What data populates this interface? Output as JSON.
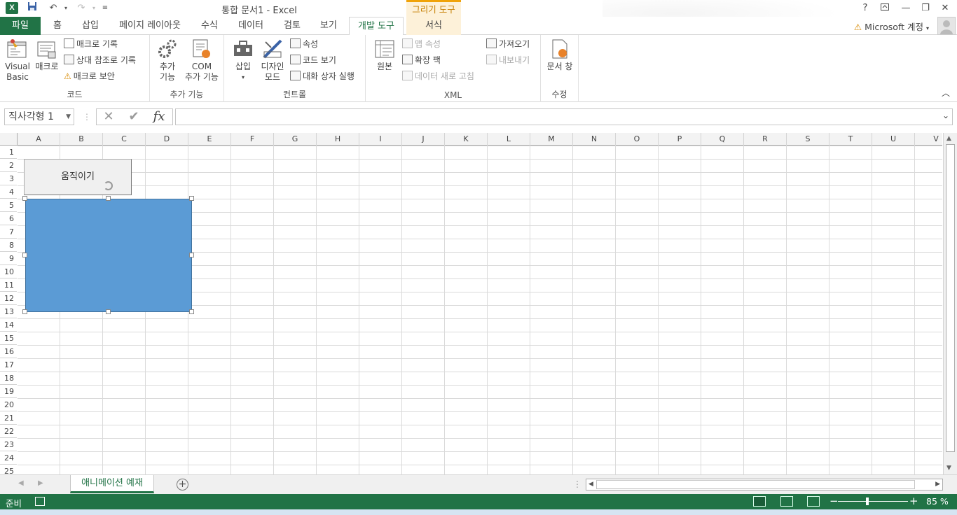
{
  "window": {
    "title": "통합 문서1 - Excel",
    "context_tab_group": "그리기 도구",
    "help": "?",
    "minimize": "—",
    "restore": "❐",
    "close": "✕"
  },
  "tabs": {
    "file": "파일",
    "items": [
      "홈",
      "삽입",
      "페이지 레이아웃",
      "수식",
      "데이터",
      "검토",
      "보기",
      "개발 도구",
      "서식"
    ],
    "active": "개발 도구",
    "account": "Microsoft 계정"
  },
  "ribbon": {
    "code": {
      "label": "코드",
      "visual_basic_1": "Visual",
      "visual_basic_2": "Basic",
      "macro": "매크로",
      "record_macro": "매크로 기록",
      "relative_ref": "상대 참조로 기록",
      "macro_security": "매크로 보안"
    },
    "addins": {
      "label": "추가 기능",
      "addins_1": "추가",
      "addins_2": "기능",
      "com_1": "COM",
      "com_2": "추가 기능"
    },
    "controls": {
      "label": "컨트롤",
      "insert": "삽입",
      "design_1": "디자인",
      "design_2": "모드",
      "properties": "속성",
      "view_code": "코드 보기",
      "run_dialog": "대화 상자 실행"
    },
    "xml": {
      "label": "XML",
      "source": "원본",
      "map_props": "맵 속성",
      "expansion": "확장 팩",
      "refresh": "데이터 새로 고침",
      "import": "가져오기",
      "export": "내보내기"
    },
    "modify": {
      "label": "수정",
      "doc_panel": "문서 창"
    }
  },
  "formula_bar": {
    "name_box": "직사각형 1",
    "cancel": "✕",
    "enter": "✔",
    "fx": "fx",
    "formula": ""
  },
  "columns": [
    "A",
    "B",
    "C",
    "D",
    "E",
    "F",
    "G",
    "H",
    "I",
    "J",
    "K",
    "L",
    "M",
    "N",
    "O",
    "P",
    "Q",
    "R",
    "S",
    "T",
    "U",
    "V"
  ],
  "rows": [
    "1",
    "2",
    "3",
    "4",
    "5",
    "6",
    "7",
    "8",
    "9",
    "10",
    "11",
    "12",
    "13",
    "14",
    "15",
    "16",
    "17",
    "18",
    "19",
    "20",
    "21",
    "22",
    "23",
    "24",
    "25"
  ],
  "shapes": {
    "button_label": "움직이기",
    "rectangle_color": "#5b9bd5"
  },
  "sheets": {
    "active": "애니메이션 예재",
    "add": "+"
  },
  "status": {
    "ready": "준비",
    "zoom": "85 %"
  },
  "colors": {
    "accent": "#217346",
    "context": "#f0a30a"
  }
}
